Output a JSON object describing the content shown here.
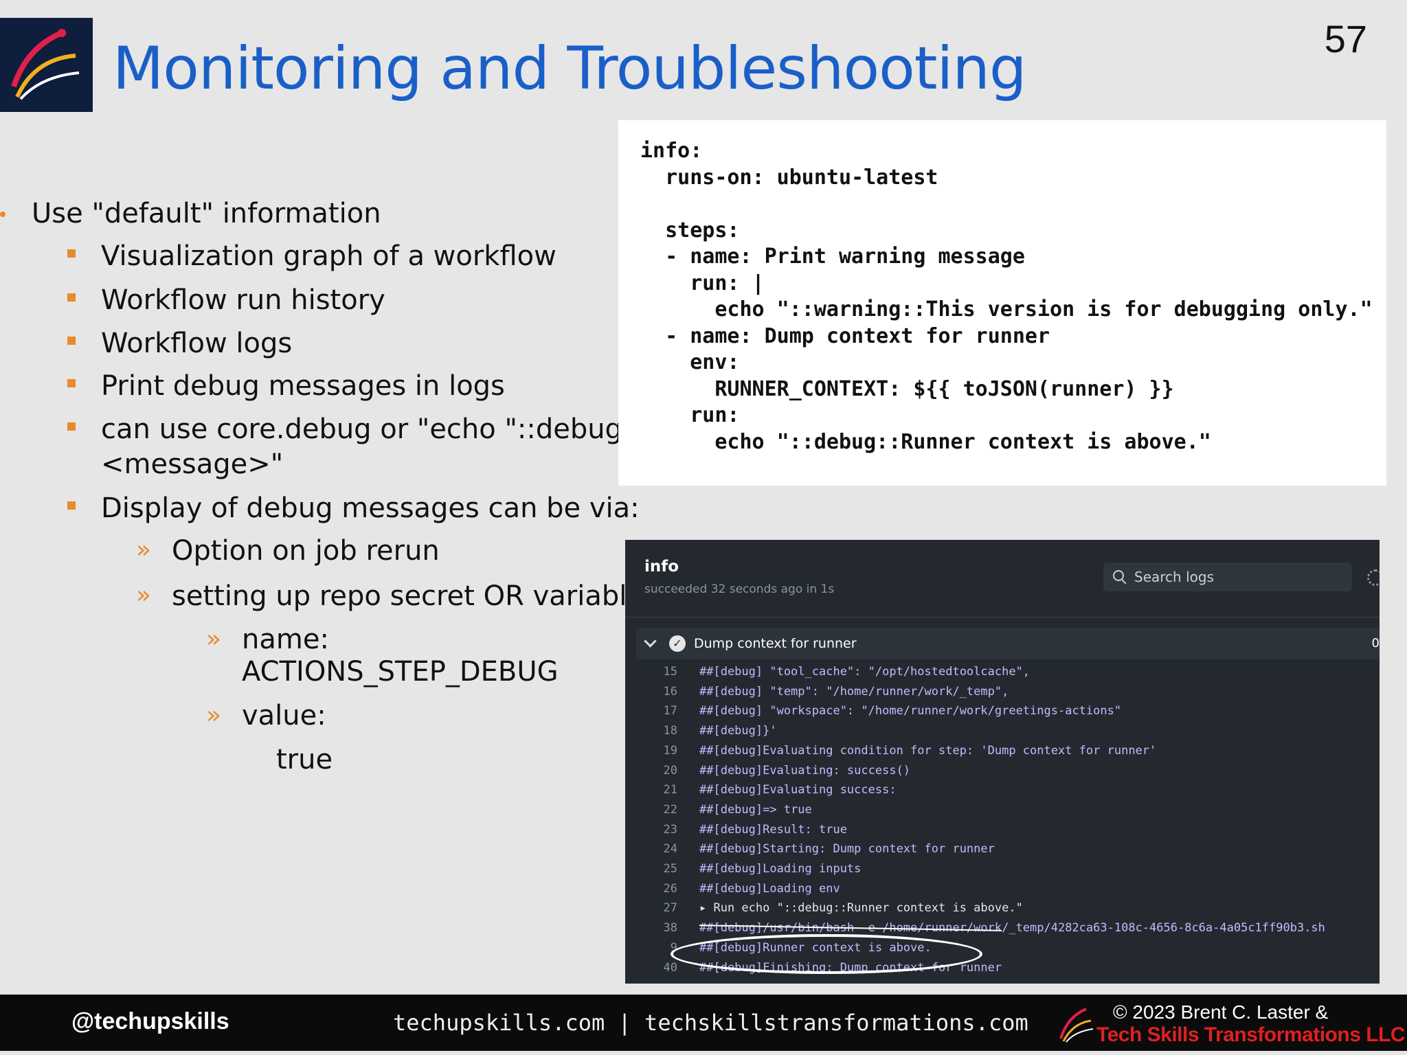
{
  "slide": {
    "title": "Monitoring and Troubleshooting",
    "page_number": "57"
  },
  "bullets": {
    "level1": "Use \"default\" information",
    "level2": [
      "Visualization graph of a workflow",
      "Workflow run history",
      "Workflow logs",
      "Print debug messages in logs",
      "can use core.debug or \"echo \"::debug::",
      "<message>\"",
      "Display of debug messages can be via:"
    ],
    "level3": [
      "Option on job rerun",
      "setting up repo secret OR variable"
    ],
    "level4": [
      "name:",
      "ACTIONS_STEP_DEBUG",
      "value:",
      "true"
    ]
  },
  "code": "info:\n  runs-on: ubuntu-latest\n\n  steps:\n  - name: Print warning message\n    run: |\n      echo \"::warning::This version is for debugging only.\"\n  - name: Dump context for runner\n    env:\n      RUNNER_CONTEXT: ${{ toJSON(runner) }}\n    run:\n      echo \"::debug::Runner context is above.\"",
  "terminal": {
    "title": "info",
    "subtitle": "succeeded 32 seconds ago in 1s",
    "search_placeholder": "Search logs",
    "step_label": "Dump context for runner",
    "step_duration": "0",
    "lines": [
      {
        "n": "15",
        "t": "##[debug]  \"tool_cache\": \"/opt/hostedtoolcache\","
      },
      {
        "n": "16",
        "t": "##[debug]  \"temp\": \"/home/runner/work/_temp\","
      },
      {
        "n": "17",
        "t": "##[debug]  \"workspace\": \"/home/runner/work/greetings-actions\""
      },
      {
        "n": "18",
        "t": "##[debug]}'"
      },
      {
        "n": "19",
        "t": "##[debug]Evaluating condition for step: 'Dump context for runner'"
      },
      {
        "n": "20",
        "t": "##[debug]Evaluating: success()"
      },
      {
        "n": "21",
        "t": "##[debug]Evaluating success:"
      },
      {
        "n": "22",
        "t": "##[debug]=> true"
      },
      {
        "n": "23",
        "t": "##[debug]Result: true"
      },
      {
        "n": "24",
        "t": "##[debug]Starting: Dump context for runner"
      },
      {
        "n": "25",
        "t": "##[debug]Loading inputs"
      },
      {
        "n": "26",
        "t": "##[debug]Loading env"
      },
      {
        "n": "27",
        "t": "▸ Run echo \"::debug::Runner context is above.\""
      },
      {
        "n": "38",
        "t": "##[debug]/usr/bin/bash -e /home/runner/work/_temp/4282ca63-108c-4656-8c6a-4a05c1ff90b3.sh"
      },
      {
        "n": "9",
        "t": "##[debug]Runner context is above."
      },
      {
        "n": "40",
        "t": "##[debug]Finishing: Dump context for runner"
      }
    ]
  },
  "footer": {
    "handle": "@techupskills",
    "sites": "techupskills.com | techskillstransformations.com",
    "copyright_line1": "© 2023 Brent C. Laster &",
    "copyright_line2": "Tech Skills Transformations LLC"
  },
  "colors": {
    "title_blue": "#1a5fc8",
    "bullet_orange": "#e88a2e",
    "terminal_bg": "#24292f",
    "debug_purple": "#c8b8ff",
    "footer_red": "#e02020"
  }
}
